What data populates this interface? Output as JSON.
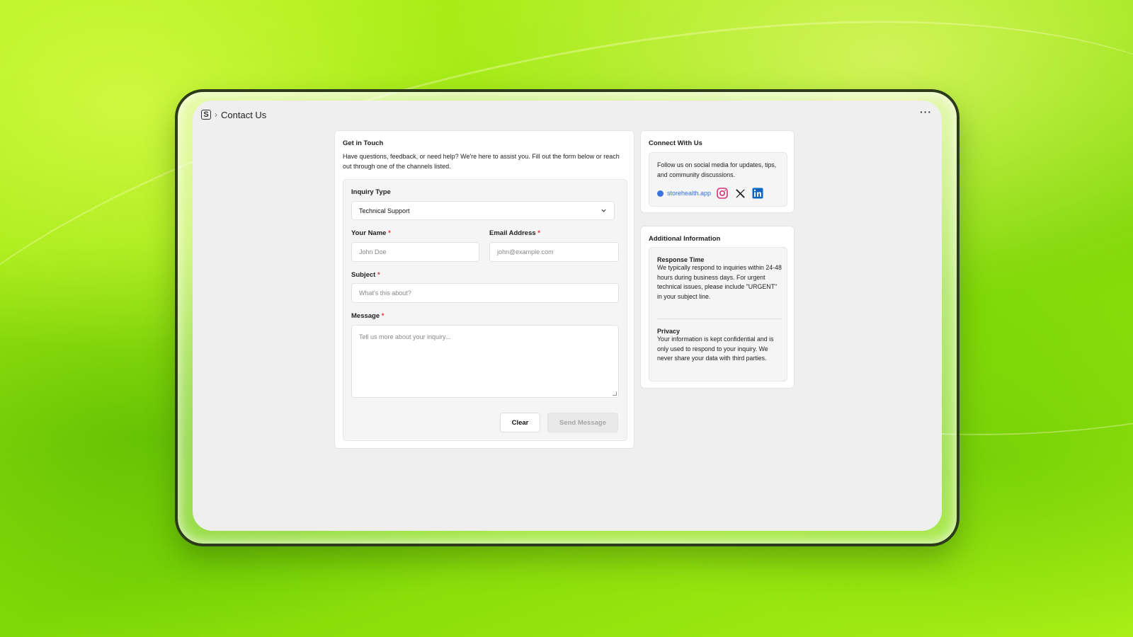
{
  "header": {
    "logo_glyph": "S",
    "separator": "›",
    "title": "Contact Us",
    "more_label": "···"
  },
  "contact_form": {
    "title": "Get in Touch",
    "intro": "Have questions, feedback, or need help? We're here to assist you. Fill out the form below or reach out through one of the channels listed.",
    "inquiry_type": {
      "label": "Inquiry Type",
      "selected_value": "Technical Support"
    },
    "name": {
      "label": "Your Name",
      "required_mark": "*",
      "placeholder": "John Doe"
    },
    "email": {
      "label": "Email Address",
      "required_mark": "*",
      "placeholder": "john@example.com"
    },
    "subject": {
      "label": "Subject",
      "required_mark": "*",
      "placeholder": "What's this about?"
    },
    "message": {
      "label": "Message",
      "required_mark": "*",
      "placeholder": "Tell us more about your inquiry..."
    },
    "buttons": {
      "clear": "Clear",
      "send": "Send Message"
    }
  },
  "connect": {
    "title": "Connect With Us",
    "text": "Follow us on social media for updates, tips, and community discussions.",
    "website": "storehealth.app",
    "social_icons": [
      "globe-icon",
      "instagram-icon",
      "x-icon",
      "linkedin-icon"
    ]
  },
  "additional_info": {
    "title": "Additional Information",
    "sections": [
      {
        "heading": "Response Time",
        "body": "We typically respond to inquiries within 24-48 hours during business days. For urgent technical issues, please include \"URGENT\" in your subject line."
      },
      {
        "heading": "Privacy",
        "body": "Your information is kept confidential and is only used to respond to your inquiry. We never share your data with third parties."
      }
    ]
  },
  "colors": {
    "wallpaper": "#9be40f",
    "link": "#2f6fe0",
    "required": "#e03030",
    "instagram": "#d6307a",
    "linkedin": "#0a66c2"
  }
}
